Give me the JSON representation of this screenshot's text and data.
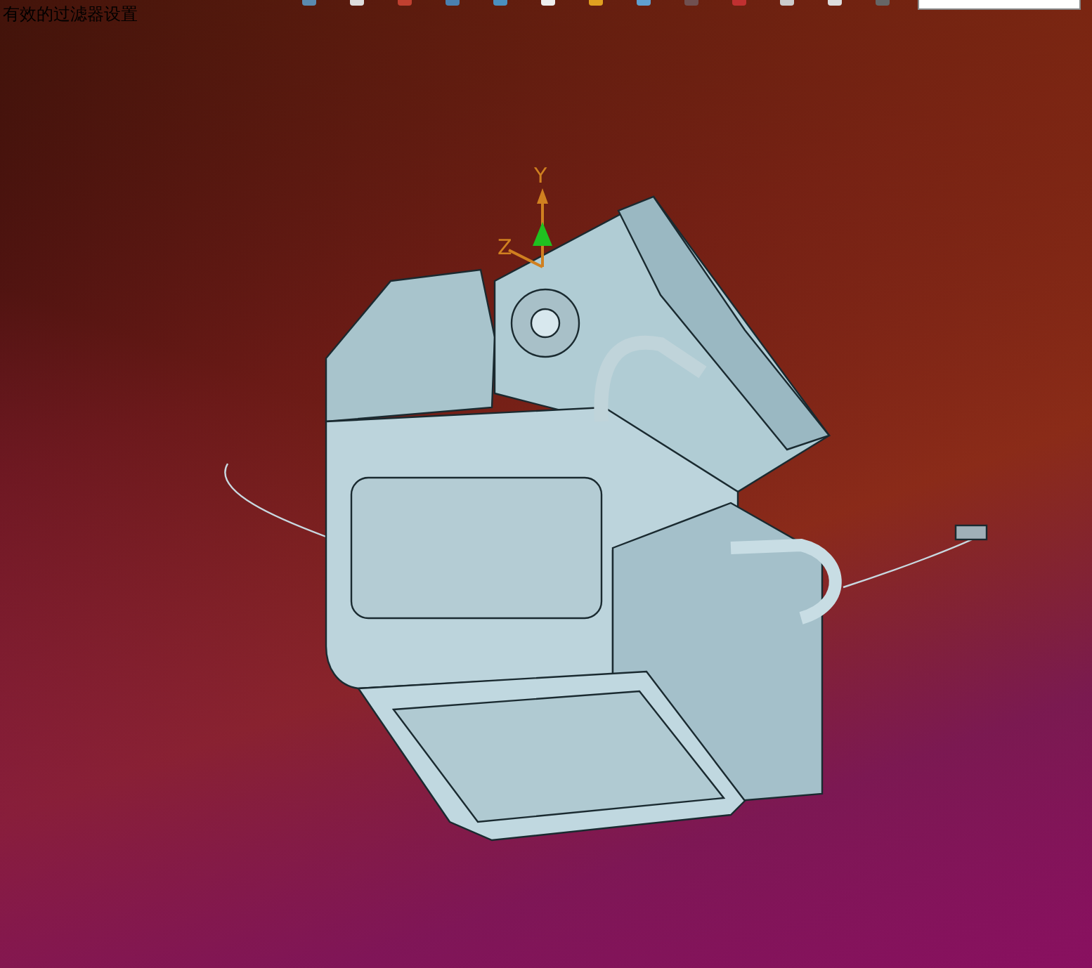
{
  "status_text": "有效的过滤器设置",
  "axes": [
    {
      "label": "Y",
      "kind": "y"
    },
    {
      "label": "Z",
      "kind": "z"
    }
  ]
}
